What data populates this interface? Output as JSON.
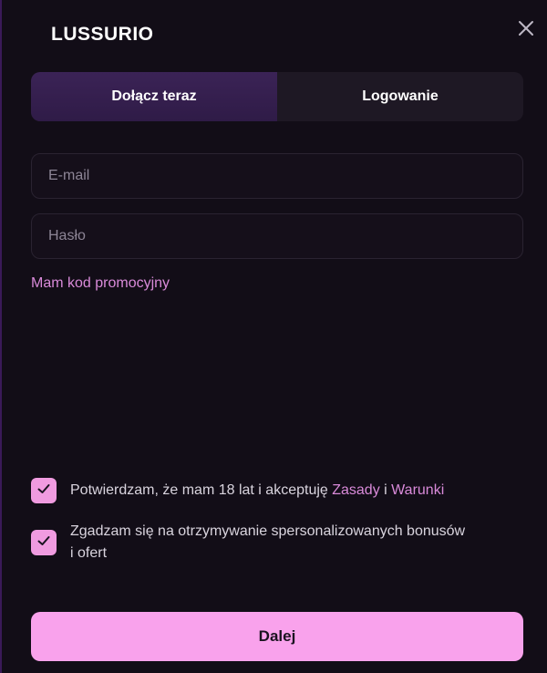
{
  "brand": {
    "logo_text": "LUSSURIO"
  },
  "tabs": [
    {
      "label": "Dołącz teraz",
      "active": true
    },
    {
      "label": "Logowanie",
      "active": false
    }
  ],
  "form": {
    "email_placeholder": "E-mail",
    "email_value": "",
    "password_placeholder": "Hasło",
    "password_value": ""
  },
  "promo": {
    "label": "Mam kod promocyjny"
  },
  "consent": {
    "age_checked": true,
    "age_text": "Potwierdzam, że mam 18 lat i akceptuję ",
    "age_link_rules": "Zasady",
    "age_and": " i ",
    "age_link_terms": "Warunki",
    "marketing_checked": true,
    "marketing_text": "Zgadzam się na otrzymywanie spersonalizowanych bonusów i ofert"
  },
  "submit": {
    "label": "Dalej"
  },
  "colors": {
    "accent": "#f9a2ec",
    "link": "#d98ad9",
    "active_tab": "#3b2356",
    "background": "#120d17"
  },
  "icons": {
    "close": "close-icon",
    "check": "checkmark-icon"
  }
}
